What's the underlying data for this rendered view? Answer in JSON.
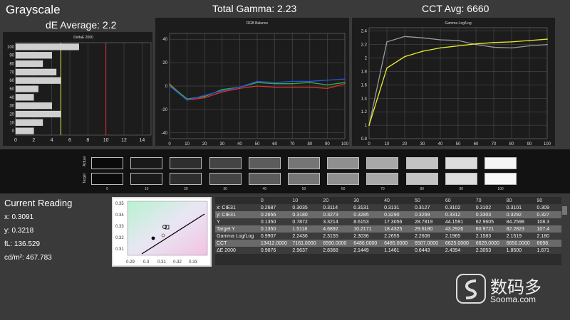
{
  "header": {
    "grayscale": "Grayscale",
    "de_average": "dE Average: 2.2",
    "total_gamma": "Total Gamma: 2.23",
    "cct_avg": "CCT Avg: 6660"
  },
  "chart_data": [
    {
      "type": "bar",
      "title": "DeltaE 2000",
      "orientation": "horizontal",
      "categories": [
        "100",
        "90",
        "80",
        "70",
        "60",
        "50",
        "40",
        "30",
        "20",
        "10",
        "0"
      ],
      "values": [
        7.0,
        4.0,
        3.0,
        4.5,
        5.0,
        2.5,
        2.0,
        4.0,
        5.0,
        3.0,
        2.0
      ],
      "xticks": [
        "0",
        "2",
        "4",
        "6",
        "8",
        "10",
        "12",
        "14"
      ],
      "xlim": [
        0,
        15
      ],
      "yticks": [
        "100",
        "90",
        "80",
        "70",
        "60",
        "50",
        "40",
        "30",
        "20",
        "10",
        "0"
      ],
      "reference_lines": [
        {
          "x": 5,
          "color": "#e8e84a"
        },
        {
          "x": 10,
          "color": "#e03030"
        }
      ]
    },
    {
      "type": "line",
      "title": "RGB Balance",
      "x": [
        0,
        10,
        20,
        30,
        40,
        50,
        60,
        70,
        80,
        90,
        100
      ],
      "xticks": [
        "0",
        "10",
        "20",
        "30",
        "40",
        "50",
        "60",
        "70",
        "80",
        "90",
        "100"
      ],
      "yticks": [
        "40",
        "20",
        "0",
        "-20",
        "-40"
      ],
      "ylim": [
        -45,
        45
      ],
      "series": [
        {
          "color": "#e03030",
          "values": [
            2,
            -12,
            -10,
            -5,
            -2,
            0,
            -1,
            -1,
            -1,
            -2,
            2
          ]
        },
        {
          "color": "#30b040",
          "values": [
            1,
            -11,
            -9,
            -3,
            -1,
            3,
            2,
            2,
            3,
            1,
            3
          ]
        },
        {
          "color": "#3050e0",
          "values": [
            0,
            -12,
            -8,
            -4,
            -1,
            4,
            3,
            4,
            4,
            5,
            6
          ]
        }
      ]
    },
    {
      "type": "line",
      "title": "Gamma Log/Log",
      "x": [
        0,
        10,
        20,
        30,
        40,
        50,
        60,
        70,
        80,
        90,
        100
      ],
      "xticks": [
        "0",
        "10",
        "20",
        "30",
        "40",
        "50",
        "60",
        "70",
        "80",
        "90",
        "100"
      ],
      "yticks": [
        "2.4",
        "2.2",
        "2",
        "1.8",
        "1.6",
        "1.4",
        "1.2",
        "1",
        "0.8"
      ],
      "ylim": [
        0.8,
        2.45
      ],
      "series": [
        {
          "color": "#9a9a9a",
          "values": [
            1.0,
            2.24,
            2.32,
            2.3,
            2.27,
            2.26,
            2.2,
            2.16,
            2.15,
            2.18,
            2.2
          ]
        },
        {
          "color": "#ecec2a",
          "values": [
            1.0,
            1.85,
            2.02,
            2.1,
            2.15,
            2.18,
            2.21,
            2.23,
            2.24,
            2.26,
            2.28
          ]
        }
      ]
    }
  ],
  "swatches": {
    "actual_label": "Actual",
    "target_label": "Target",
    "labels": [
      "0",
      "10",
      "20",
      "30",
      "40",
      "50",
      "60",
      "70",
      "80",
      "90",
      "100"
    ],
    "actual_colors": [
      "#0a0a0a",
      "#1a1a1a",
      "#2e2e2e",
      "#444444",
      "#5c5c5c",
      "#757575",
      "#8f8f8f",
      "#a8a8a8",
      "#c2c2c2",
      "#dcdcdc",
      "#f5f5f5"
    ],
    "target_colors": [
      "#0a0a0a",
      "#1a1a1a",
      "#2e2e2e",
      "#444444",
      "#5c5c5c",
      "#767676",
      "#8f8f8f",
      "#a9a9a9",
      "#c3c3c3",
      "#dddddd",
      "#f7f7f7"
    ]
  },
  "current_reading": {
    "title": "Current Reading",
    "x": "x: 0.3091",
    "y": "y: 0.3218",
    "fl": "fL: 136.529",
    "cdm2": "cd/m²: 467.783"
  },
  "cie_plot": {
    "xticks": [
      "0.29",
      "0.3",
      "0.31",
      "0.32",
      "0.33"
    ],
    "yticks": [
      "0.35",
      "0.34",
      "0.33",
      "0.32",
      "0.31"
    ]
  },
  "table": {
    "columns": [
      "",
      "0",
      "10",
      "20",
      "30",
      "40",
      "50",
      "60",
      "70",
      "80",
      "90"
    ],
    "rows": [
      [
        "x: CIE31",
        "0.2687",
        "0.3035",
        "0.3114",
        "0.3131",
        "0.3131",
        "0.3127",
        "0.3102",
        "0.3102",
        "0.3101",
        "0.309"
      ],
      [
        "y: CIE31",
        "0.2656",
        "0.3180",
        "0.3273",
        "0.3285",
        "0.3290",
        "0.3269",
        "0.3312",
        "0.3303",
        "0.3292",
        "0.327"
      ],
      [
        "Y",
        "0.1350",
        "0.7872",
        "3.3214",
        "8.6153",
        "17.3056",
        "28.7819",
        "44.1591",
        "62.9605",
        "84.2598",
        "108.3"
      ],
      [
        "Target Y",
        "0.1350",
        "1.5118",
        "4.6892",
        "10.2171",
        "18.4325",
        "29.6180",
        "43.2926",
        "60.9721",
        "82.2823",
        "107.4"
      ],
      [
        "Gamma Log/Log",
        "0.9907",
        "2.2436",
        "2.3155",
        "2.3036",
        "2.2655",
        "2.2608",
        "2.1965",
        "2.1583",
        "2.1519",
        "2.180"
      ],
      [
        "CCT",
        "13412.0000",
        "7161.0000",
        "6590.0000",
        "6486.0000",
        "6485.0000",
        "6507.0000",
        "6625.0000",
        "6629.0000",
        "6650.0000",
        "6698."
      ],
      [
        "ΔE 2000",
        "0.9876",
        "2.9637",
        "2.8368",
        "2.1449",
        "1.1461",
        "0.6443",
        "2.4394",
        "2.3053",
        "1.8500",
        "1.671"
      ]
    ]
  },
  "watermark": {
    "cn": "数码多",
    "en": "Sooma.com"
  }
}
